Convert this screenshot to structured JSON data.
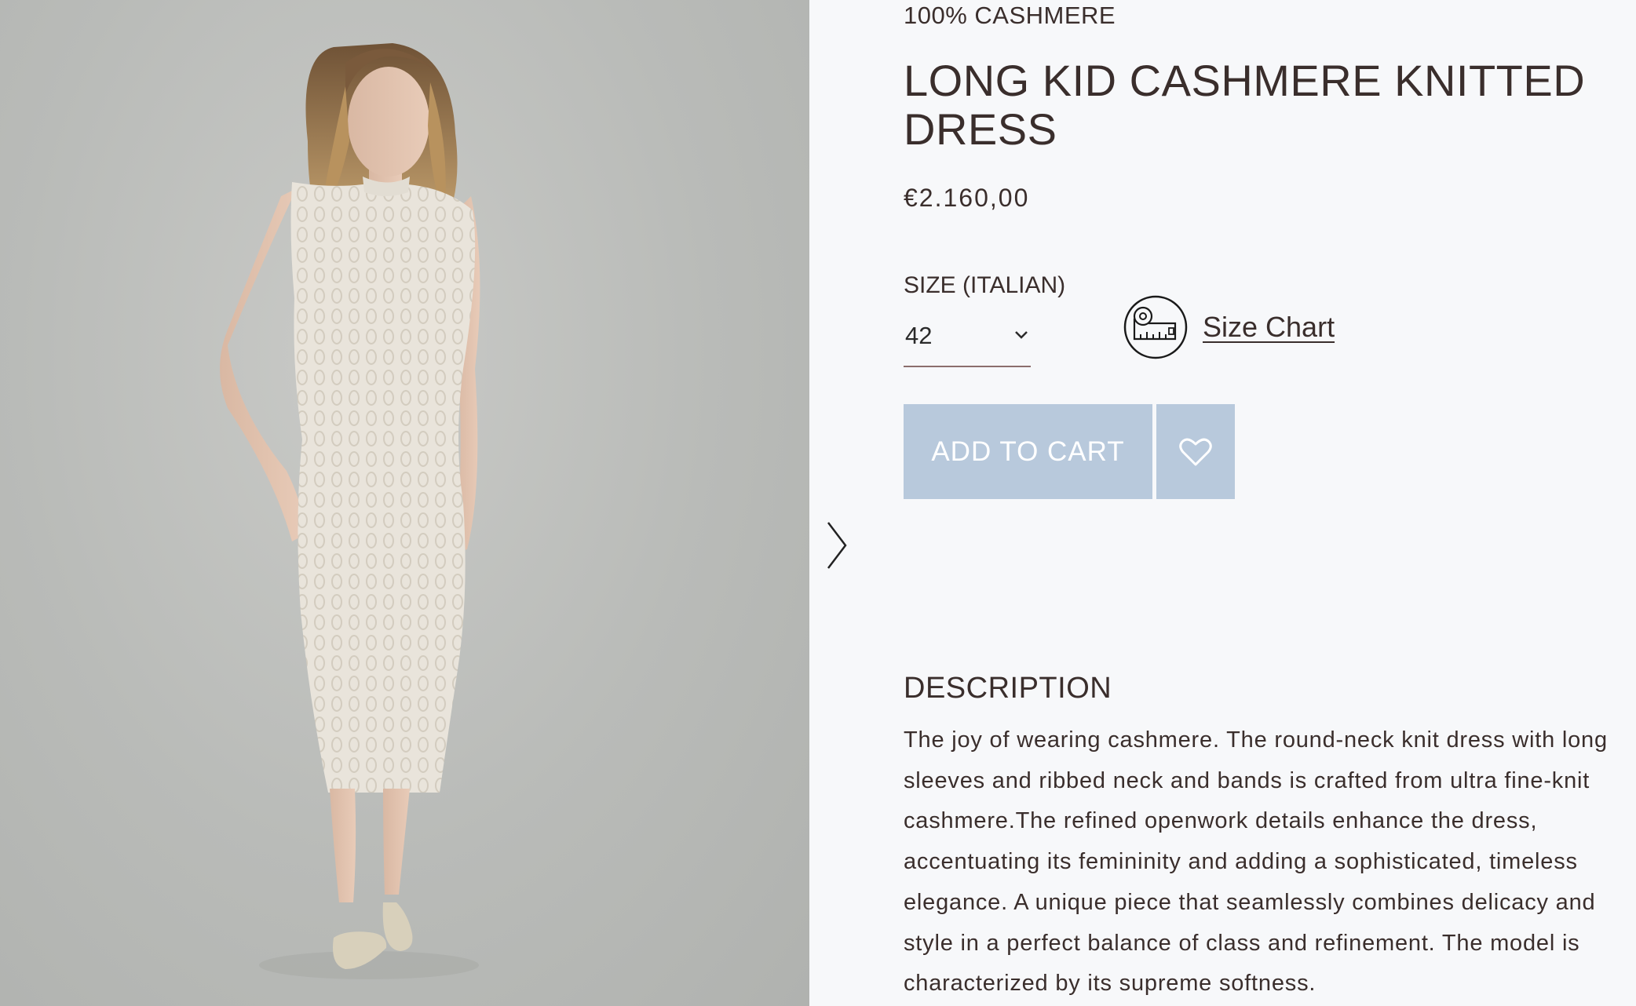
{
  "gallery": {
    "image_alt": "Model wearing long cream kid cashmere openwork knitted dress",
    "next_icon": "chevron-right-icon"
  },
  "product": {
    "material": "100% CASHMERE",
    "title": "LONG KID CASHMERE KNITTED DRESS",
    "price": "€2.160,00"
  },
  "size": {
    "label": "SIZE (ITALIAN)",
    "selected": "42",
    "chevron_icon": "chevron-down-icon",
    "chart_icon": "measuring-tape-icon",
    "chart_link": "Size Chart"
  },
  "actions": {
    "add_to_cart": "ADD TO CART",
    "wishlist_icon": "heart-icon"
  },
  "description": {
    "heading": "DESCRIPTION",
    "body": "The joy of wearing cashmere. The round-neck knit dress with long sleeves and ribbed neck and bands is crafted from ultra fine-knit cashmere.The refined openwork details enhance the dress, accentuating its femininity and adding a sophisticated, timeless elegance. A unique piece that seamlessly combines delicacy and style in a perfect balance of class and refinement. The model is characterized by its supreme softness."
  },
  "colors": {
    "text": "#3a2e2c",
    "button_bg": "#b8c9dc",
    "page_bg": "#f7f8fa"
  }
}
